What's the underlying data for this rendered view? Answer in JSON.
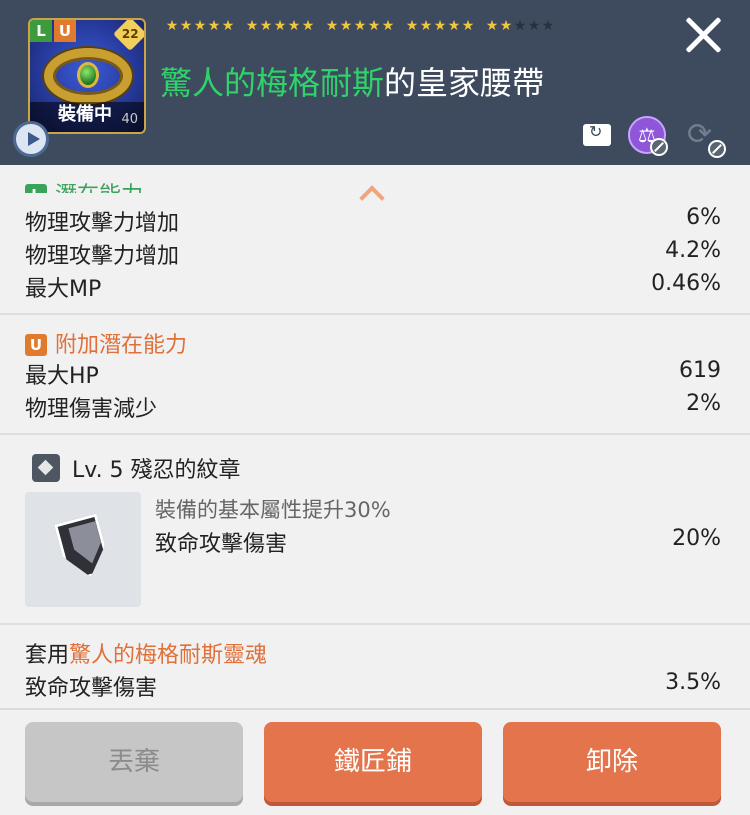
{
  "item": {
    "grade_left": "L",
    "grade_right": "U",
    "level_badge": "22",
    "equipped_label": "裝備中",
    "item_level": "40",
    "title_green": "驚人的梅格耐斯",
    "title_rest": "的皇家腰帶",
    "stars_total": 25,
    "stars_filled": 22
  },
  "header_icons": [
    "transfer-icon",
    "scale-icon",
    "cycle-icon"
  ],
  "potential": {
    "badge": "L",
    "title": "潛在能力",
    "rows": [
      {
        "label": "物理攻擊力增加",
        "value": "6%"
      },
      {
        "label": "物理攻擊力增加",
        "value": "4.2%"
      },
      {
        "label": "最大MP",
        "value": "0.46%"
      }
    ]
  },
  "additional": {
    "badge": "U",
    "title": "附加潛在能力",
    "rows": [
      {
        "label": "最大HP",
        "value": "619"
      },
      {
        "label": "物理傷害減少",
        "value": "2%"
      }
    ]
  },
  "emblem": {
    "title": "Lv. 5 殘忍的紋章",
    "desc": "裝備的基本屬性提升30%",
    "stat_label": "致命攻擊傷害",
    "stat_value": "20%"
  },
  "set": {
    "prefix": "套用",
    "name": "驚人的梅格耐斯靈魂",
    "stat_label": "致命攻擊傷害",
    "stat_value": "3.5%"
  },
  "buttons": {
    "discard": "丟棄",
    "smith": "鐵匠鋪",
    "unequip": "卸除"
  }
}
